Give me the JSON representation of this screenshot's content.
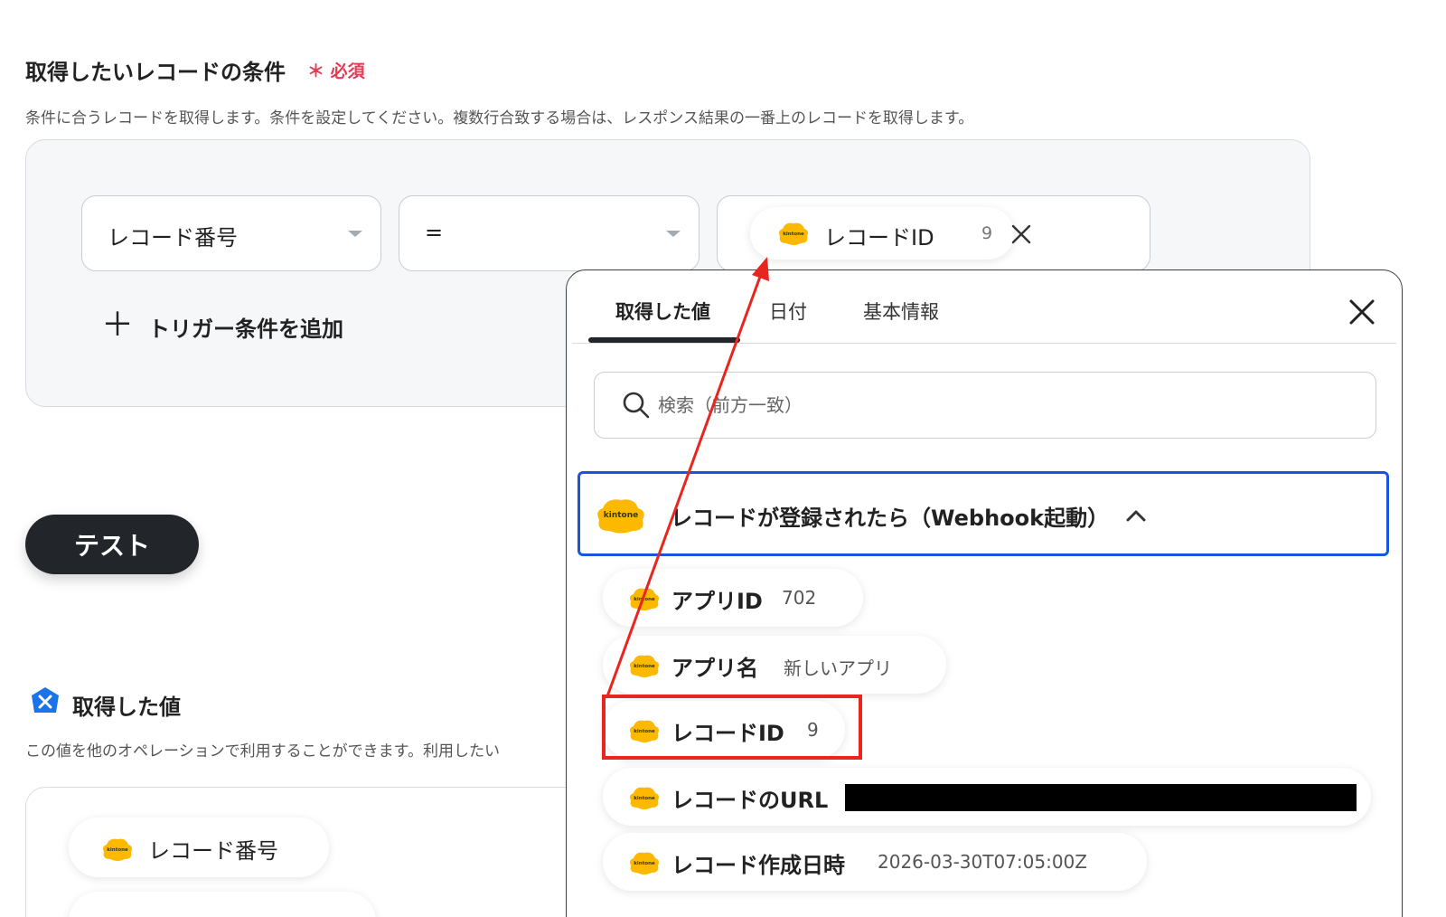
{
  "condition": {
    "title": "取得したいレコードの条件",
    "required": "＊ 必須",
    "description": "条件に合うレコードを取得します。条件を設定してください。複数行合致する場合は、レスポンス結果の一番上のレコードを取得します。",
    "field_select": "レコード番号",
    "operator_select": "=",
    "value_chip": {
      "label": "レコードID",
      "value": "9"
    },
    "add_label": "トリガー条件を追加",
    "add_icon": "＋"
  },
  "test_button": "テスト",
  "values": {
    "title": "取得した値",
    "description": "この値を他のオペレーションで利用することができます。利用したい",
    "chip_label": "レコード番号"
  },
  "dropdown": {
    "tabs": [
      {
        "label": "取得した値",
        "active": true
      },
      {
        "label": "日付",
        "active": false
      },
      {
        "label": "基本情報",
        "active": false
      }
    ],
    "search_placeholder": "検索（前方一致）",
    "group_title": "レコードが登録されたら（Webhook起動）",
    "items": [
      {
        "label": "アプリID",
        "value": "702"
      },
      {
        "label": "アプリ名",
        "value": "新しいアプリ"
      },
      {
        "label": "レコードID",
        "value": "9"
      },
      {
        "label": "レコードのURL",
        "value": ""
      },
      {
        "label": "レコード作成日時",
        "value": "2026-03-30T07:05:00Z"
      }
    ]
  },
  "brand": {
    "logo_text": "kintone",
    "logo_color": "#fcb900",
    "accent": "#1a56db",
    "annotation": "#e8251e"
  }
}
